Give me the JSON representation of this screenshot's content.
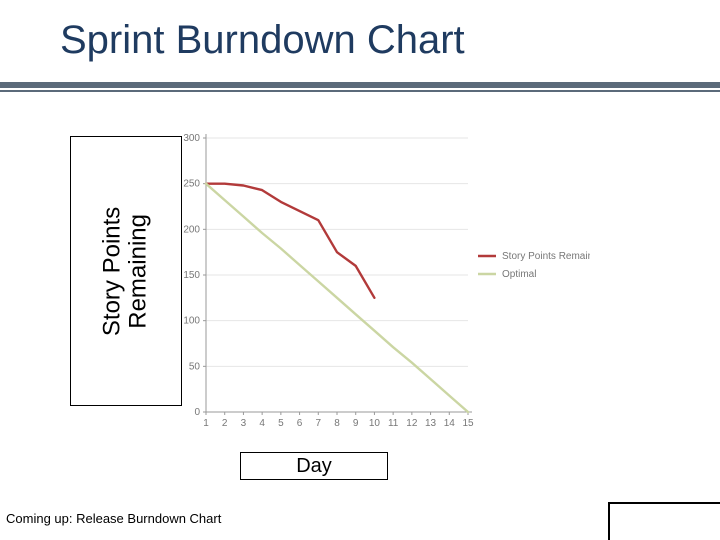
{
  "title": "Sprint Burndown Chart",
  "ylabel": "Story Points\nRemaining",
  "xlabel": "Day",
  "footer": "Coming up: Release Burndown Chart",
  "legend": {
    "remaining": "Story Points Remaining",
    "optimal": "Optimal"
  },
  "chart_data": {
    "type": "line",
    "xlabel": "Day",
    "ylabel": "Story Points Remaining",
    "title": "Sprint Burndown Chart",
    "x": [
      1,
      2,
      3,
      4,
      5,
      6,
      7,
      8,
      9,
      10,
      11,
      12,
      13,
      14,
      15
    ],
    "ylim": [
      0,
      300
    ],
    "xlim": [
      1,
      15
    ],
    "y_ticks": [
      0,
      50,
      100,
      150,
      200,
      250,
      300
    ],
    "series": [
      {
        "name": "Story Points Remaining",
        "color": "#b23a3a",
        "values": [
          250,
          250,
          248,
          243,
          230,
          220,
          210,
          175,
          160,
          125,
          null,
          null,
          null,
          null,
          null
        ]
      },
      {
        "name": "Optimal",
        "color": "#cbd6a3",
        "values": [
          250,
          232,
          214,
          196,
          179,
          161,
          143,
          125,
          107,
          89,
          71,
          54,
          36,
          18,
          0
        ]
      }
    ]
  }
}
